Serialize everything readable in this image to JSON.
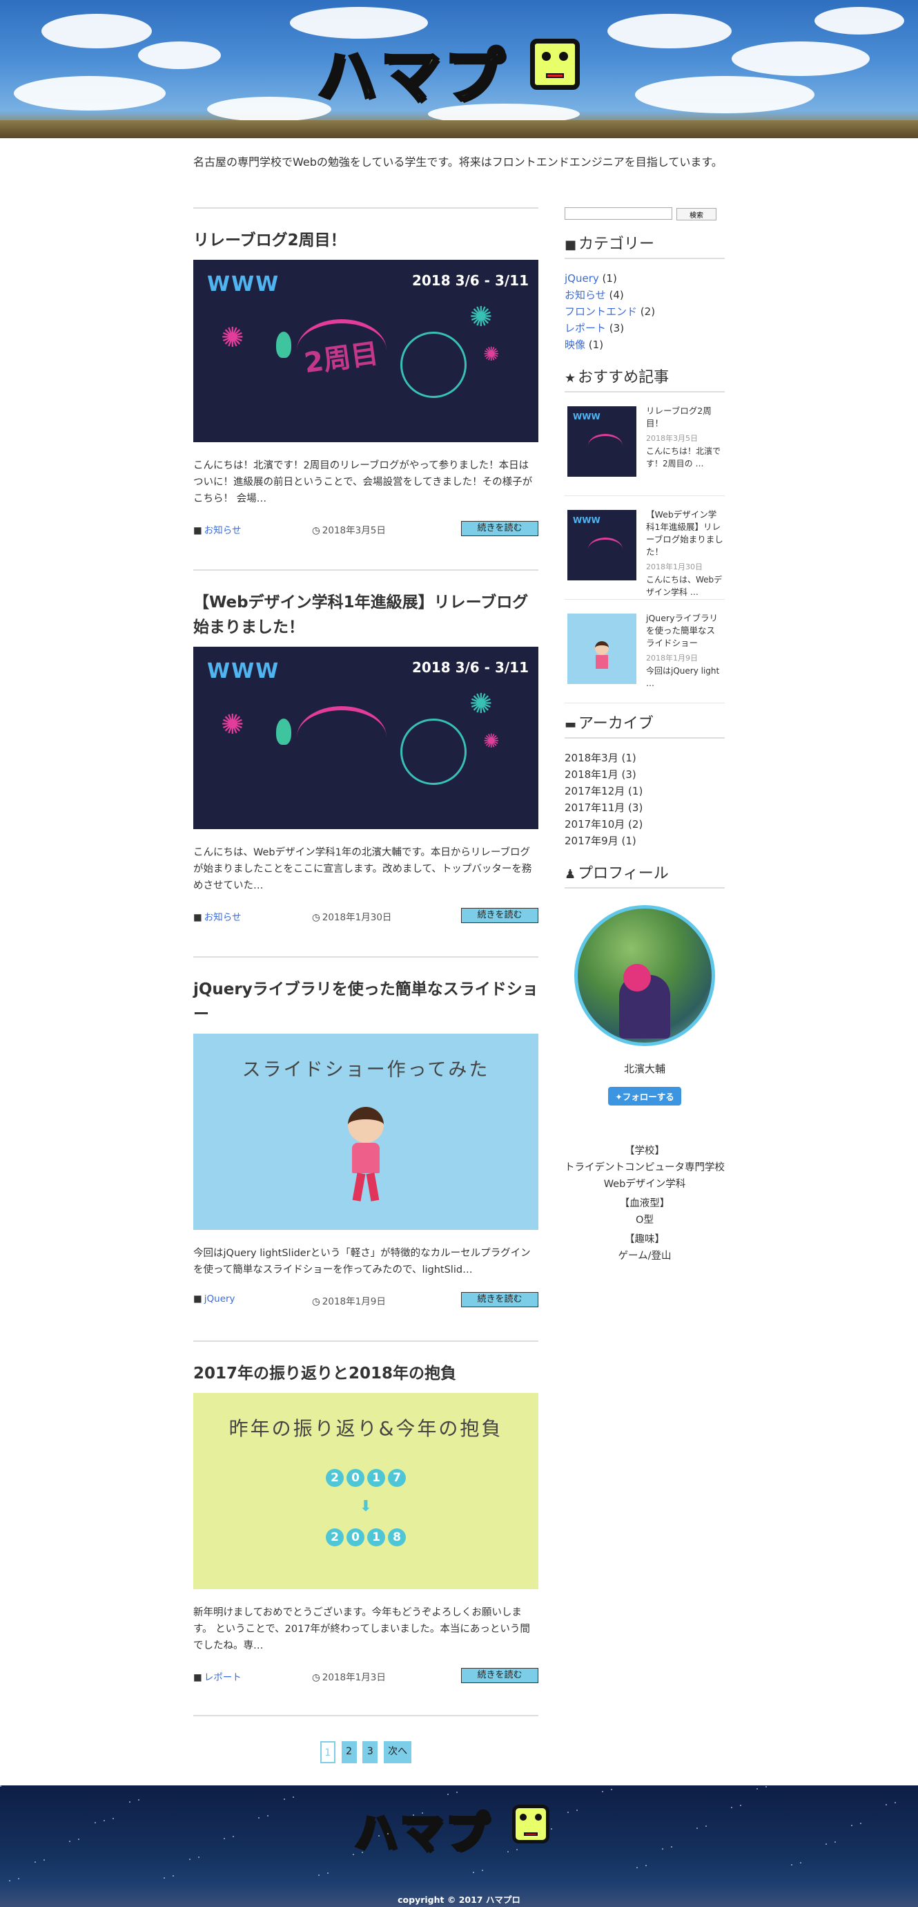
{
  "header": {
    "logo_text": "ハマプ"
  },
  "intro": "名古屋の専門学校でWebの勉強をしている学生です。将来はフロントエンドエンジニアを目指しています。",
  "posts": [
    {
      "title": "リレーブログ2周目！",
      "thumb_type": "www",
      "thumb_text": "2周目",
      "excerpt": "こんにちは！北濱です！2周目のリレーブログがやって参りました！本日はついに！進級展の前日ということで、会場設営をしてきました！その様子がこちら！ 会場…",
      "category": "お知らせ",
      "date": "2018年3月5日",
      "more_label": "続きを読む"
    },
    {
      "title": "【Webデザイン学科1年進級展】リレーブログ始まりました！",
      "thumb_type": "www",
      "thumb_text": "",
      "excerpt": "こんにちは、Webデザイン学科1年の北濱大輔です。本日からリレーブログが始まりましたことをここに宣言します。改めまして、トップバッターを務めさせていた…",
      "category": "お知らせ",
      "date": "2018年1月30日",
      "more_label": "続きを読む"
    },
    {
      "title": "jQueryライブラリを使った簡単なスライドショー",
      "thumb_type": "slide",
      "thumb_text": "スライドショー作ってみた",
      "excerpt": "今回はjQuery lightSliderという「軽さ」が特徴的なカルーセルプラグインを使って簡単なスライドショーを作ってみたので、lightSlid…",
      "category": "jQuery",
      "date": "2018年1月9日",
      "more_label": "続きを読む"
    },
    {
      "title": "2017年の振り返りと2018年の抱負",
      "thumb_type": "review",
      "thumb_text": "昨年の振り返り&今年の抱負",
      "excerpt": "新年明けましておめでとうございます。今年もどうぞよろしくお願いします。 ということで、2017年が終わってしまいました。本当にあっという間でしたね。専…",
      "category": "レポート",
      "date": "2018年1月3日",
      "more_label": "続きを読む"
    }
  ],
  "www_brand": "WWW",
  "www_dates": "2018 3/6 - 3/11",
  "review_digits": {
    "from": "2017",
    "to": "2018",
    "arrow": "⬇"
  },
  "pagination": {
    "pages": [
      "1",
      "2",
      "3"
    ],
    "next": "次へ",
    "current": "1"
  },
  "sidebar": {
    "search_button": "検索",
    "categories_title": "カテゴリー",
    "categories": [
      {
        "label": "jQuery",
        "count": "(1)"
      },
      {
        "label": "お知らせ",
        "count": "(4)"
      },
      {
        "label": "フロントエンド",
        "count": "(2)"
      },
      {
        "label": "レポート",
        "count": "(3)"
      },
      {
        "label": "映像",
        "count": "(1)"
      }
    ],
    "recommended_title": "おすすめ記事",
    "recommended": [
      {
        "title": "リレーブログ2周目！",
        "date": "2018年3月5日",
        "excerpt": "こんにちは！北濱です！2周目の …"
      },
      {
        "title": "【Webデザイン学科1年進級展】リレーブログ始まりました！",
        "date": "2018年1月30日",
        "excerpt": "こんにちは、Webデザイン学科 …"
      },
      {
        "title": "jQueryライブラリを使った簡単なスライドショー",
        "date": "2018年1月9日",
        "excerpt": "今回はjQuery light …"
      }
    ],
    "archive_title": "アーカイブ",
    "archives": [
      {
        "label": "2018年3月",
        "count": "(1)"
      },
      {
        "label": "2018年1月",
        "count": "(3)"
      },
      {
        "label": "2017年12月",
        "count": "(1)"
      },
      {
        "label": "2017年11月",
        "count": "(3)"
      },
      {
        "label": "2017年10月",
        "count": "(2)"
      },
      {
        "label": "2017年9月",
        "count": "(1)"
      }
    ],
    "profile_title": "プロフィール",
    "profile_name": "北濱大輔",
    "follow_label": "フォローする",
    "profile_info": [
      {
        "head": "【学校】",
        "body": "トライデントコンピュータ専門学校\nWebデザイン学科"
      },
      {
        "head": "【血液型】",
        "body": "O型"
      },
      {
        "head": "【趣味】",
        "body": "ゲーム/登山"
      }
    ]
  },
  "footer": {
    "logo_text": "ハマプ",
    "copyright": "copyright © 2017 ハマプロ"
  },
  "colors": {
    "accent": "#7ccde8",
    "link": "#3a6bd8",
    "logo_fill": "#e8ff6a"
  }
}
